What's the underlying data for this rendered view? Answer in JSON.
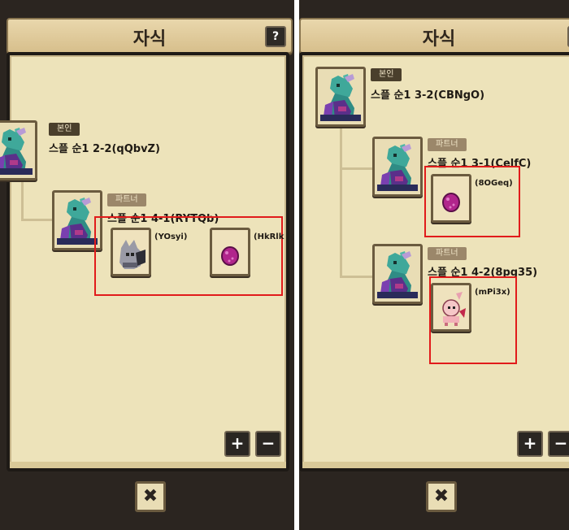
{
  "left": {
    "title": "자식",
    "help": "?",
    "self_tag": "본인",
    "self_name": "스플 순1 2-2(qQbvZ)",
    "partner_tag": "파트너",
    "partner_name": "스플 순1 4-1(RYTQb)",
    "children": [
      {
        "label": "(YOsyi)",
        "icon": "gray-creature-icon"
      },
      {
        "label": "(HkRlk",
        "icon": "pink-egg-icon"
      }
    ],
    "plus": "+",
    "minus": "−",
    "close": "✖"
  },
  "right": {
    "title": "자식",
    "help": "?",
    "self_tag": "본인",
    "self_name": "스플 순1 3-2(CBNgO)",
    "partners": [
      {
        "tag": "파트너",
        "name": "스플 순1 3-1(CelfC)",
        "child": {
          "label": "(8OGeq)",
          "icon": "pink-egg-icon"
        }
      },
      {
        "tag": "파트너",
        "name": "스플 순1 4-2(8pg35)",
        "child": {
          "label": "(mPi3x)",
          "icon": "pink-creature-icon"
        }
      }
    ],
    "plus": "+",
    "minus": "−",
    "close": "✖"
  },
  "colors": {
    "highlight": "#e11b1b",
    "panel": "#ede3ba",
    "dragon": "#3fa89a"
  }
}
